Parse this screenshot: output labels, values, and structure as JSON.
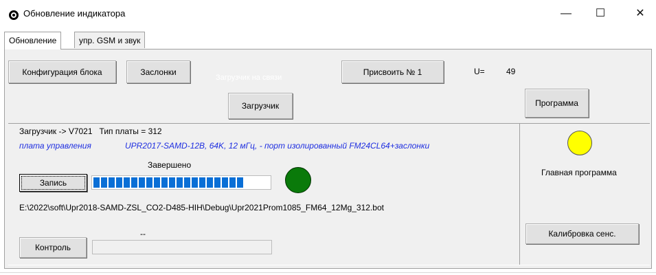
{
  "window": {
    "title": "Обновление индикатора",
    "minimize_glyph": "—",
    "maximize_glyph": "☐",
    "close_glyph": "✕",
    "icon": "app-icon"
  },
  "tabs": [
    {
      "label": "Обновление",
      "active": true
    },
    {
      "label": "упр. GSM и звук",
      "active": false
    }
  ],
  "toolbar": {
    "config_button": "Конфигурация блока",
    "dampers_button": "Заслонки",
    "assign_button": "Присвоить № 1",
    "u_label": "U=",
    "u_value": "49",
    "ghost_text": "Загрузчик на связи",
    "loader_button": "Загрузчик",
    "program_button": "Программа"
  },
  "loader_section": {
    "info_line": "Загрузчик -> V7021   Тип платы = 312",
    "board_name": "плата управления",
    "board_desc": "UPR2017-SAMD-12B, 64K, 12 мГц, - порт изолированный FM24CL64+заслонки",
    "status_text": "Завершено",
    "write_button": "Запись",
    "progress_segments": 20,
    "file_path": "E:\\2022\\soft\\Upr2018-SAMD-ZSL_CO2-D485-HIH\\Debug\\Upr2021Prom1085_FM64_12Mg_312.bot",
    "control_status": "--",
    "control_button": "Контроль",
    "indicator_color": "#0a7a0a"
  },
  "program_section": {
    "indicator_color": "#ffff00",
    "main_program_label": "Главная программа",
    "calibrate_button": "Калибровка сенс."
  }
}
